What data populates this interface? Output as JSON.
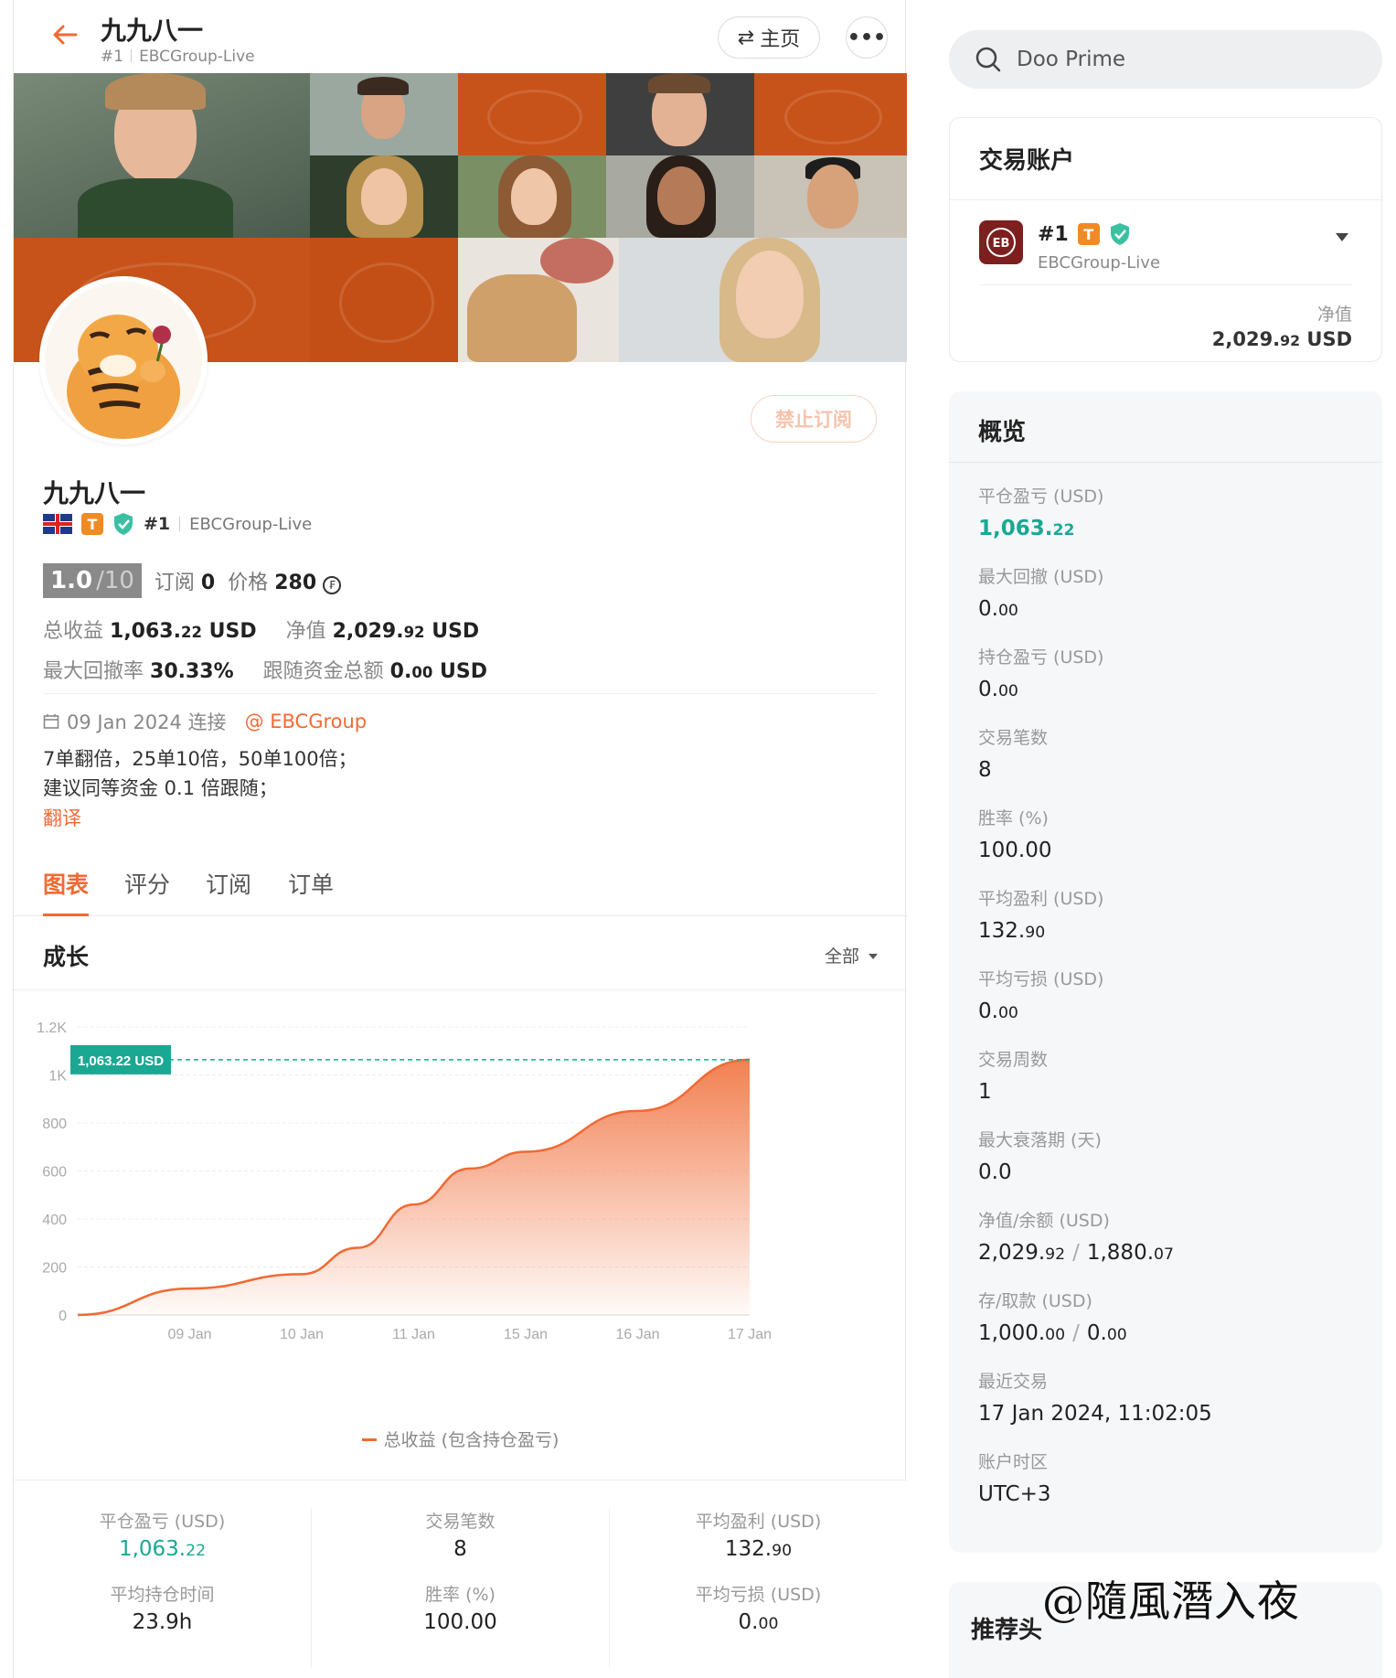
{
  "header": {
    "title": "九九八一",
    "rank": "#1",
    "server": "EBCGroup-Live",
    "home_label": "主页"
  },
  "profile": {
    "name": "九九八一",
    "rank": "#1",
    "server": "EBCGroup-Live",
    "badge_t": "T",
    "unsubscribe_label": "禁止订阅",
    "score": "1.0",
    "score_max": "/10",
    "subscribe_label": "订阅",
    "subscribe_count": "0",
    "price_label": "价格",
    "price_value": "280",
    "total_profit_label": "总收益",
    "total_profit_int": "1,063.",
    "total_profit_dec": "22",
    "equity_label": "净值",
    "equity_int": "2,029.",
    "equity_dec": "92",
    "currency": "USD",
    "max_dd_label": "最大回撤率",
    "max_dd_value": "30.33%",
    "follow_funds_label": "跟随资金总额",
    "follow_funds_int": "0.",
    "follow_funds_dec": "00",
    "connected_date": "09 Jan 2024 连接",
    "broker_link": "@ EBCGroup",
    "desc_line1": "7单翻倍，25单10倍，50单100倍；",
    "desc_line2": "建议同等资金 0.1 倍跟随；",
    "translate_label": "翻译"
  },
  "tabs": [
    "图表",
    "评分",
    "订阅",
    "订单"
  ],
  "growth": {
    "title": "成长",
    "filter": "全部"
  },
  "chart_data": {
    "type": "area",
    "x": [
      "09 Jan",
      "10 Jan",
      "11 Jan",
      "15 Jan",
      "16 Jan",
      "17 Jan"
    ],
    "y_ticks": [
      "0",
      "200",
      "400",
      "600",
      "800",
      "1K",
      "1.2K"
    ],
    "ylim": [
      0,
      1200
    ],
    "series": [
      {
        "name": "总收益 (包含持仓盈亏)",
        "points": [
          [
            0,
            0
          ],
          [
            1,
            110
          ],
          [
            2,
            170
          ],
          [
            2.5,
            280
          ],
          [
            3,
            460
          ],
          [
            3.5,
            610
          ],
          [
            4,
            680
          ],
          [
            5,
            850
          ],
          [
            6,
            1063.22
          ]
        ]
      }
    ],
    "marker_label": "1,063.22 USD",
    "marker_value": 1063.22,
    "grid": true,
    "legend": "bottom-center",
    "color": "#f06a34"
  },
  "stats": {
    "closed_pnl_label": "平仓盈亏 (USD)",
    "closed_pnl_int": "1,063.",
    "closed_pnl_dec": "22",
    "trades_label": "交易笔数",
    "trades_value": "8",
    "avg_profit_label": "平均盈利 (USD)",
    "avg_profit_int": "132.",
    "avg_profit_dec": "90",
    "avg_hold_label": "平均持仓时间",
    "avg_hold_value": "23.9h",
    "win_rate_label": "胜率 (%)",
    "win_rate_value": "100.00",
    "avg_loss_label": "平均亏损 (USD)",
    "avg_loss_int": "0.",
    "avg_loss_dec": "00"
  },
  "search": {
    "placeholder": "Doo Prime"
  },
  "account": {
    "title": "交易账户",
    "rank": "#1",
    "badge_t": "T",
    "server": "EBCGroup-Live",
    "equity_label": "净值",
    "equity_int": "2,029.",
    "equity_dec": "92",
    "currency": "USD"
  },
  "overview": {
    "title": "概览",
    "items": [
      {
        "label": "平仓盈亏 (USD)",
        "int": "1,063.",
        "dec": "22",
        "green": true
      },
      {
        "label": "最大回撤 (USD)",
        "int": "0.",
        "dec": "00"
      },
      {
        "label": "持仓盈亏 (USD)",
        "int": "0.",
        "dec": "00"
      },
      {
        "label": "交易笔数",
        "int": "8",
        "dec": ""
      },
      {
        "label": "胜率 (%)",
        "int": "100.00",
        "dec": ""
      },
      {
        "label": "平均盈利 (USD)",
        "int": "132.",
        "dec": "90"
      },
      {
        "label": "平均亏损 (USD)",
        "int": "0.",
        "dec": "00"
      },
      {
        "label": "交易周数",
        "int": "1",
        "dec": ""
      },
      {
        "label": "最大衰落期 (天)",
        "int": "0.0",
        "dec": ""
      },
      {
        "label": "净值/余额 (USD)",
        "int": "2,029.",
        "dec": "92",
        "int2": "1,880.",
        "dec2": "07"
      },
      {
        "label": "存/取款 (USD)",
        "int": "1,000.",
        "dec": "00",
        "int2": "0.",
        "dec2": "00"
      },
      {
        "label": "最近交易",
        "int": "17 Jan 2024, 11:02:05",
        "dec": ""
      },
      {
        "label": "账户时区",
        "int": "UTC+3",
        "dec": ""
      }
    ]
  },
  "recommend": {
    "title": "推荐头"
  },
  "watermark": "@隨風潛入夜"
}
